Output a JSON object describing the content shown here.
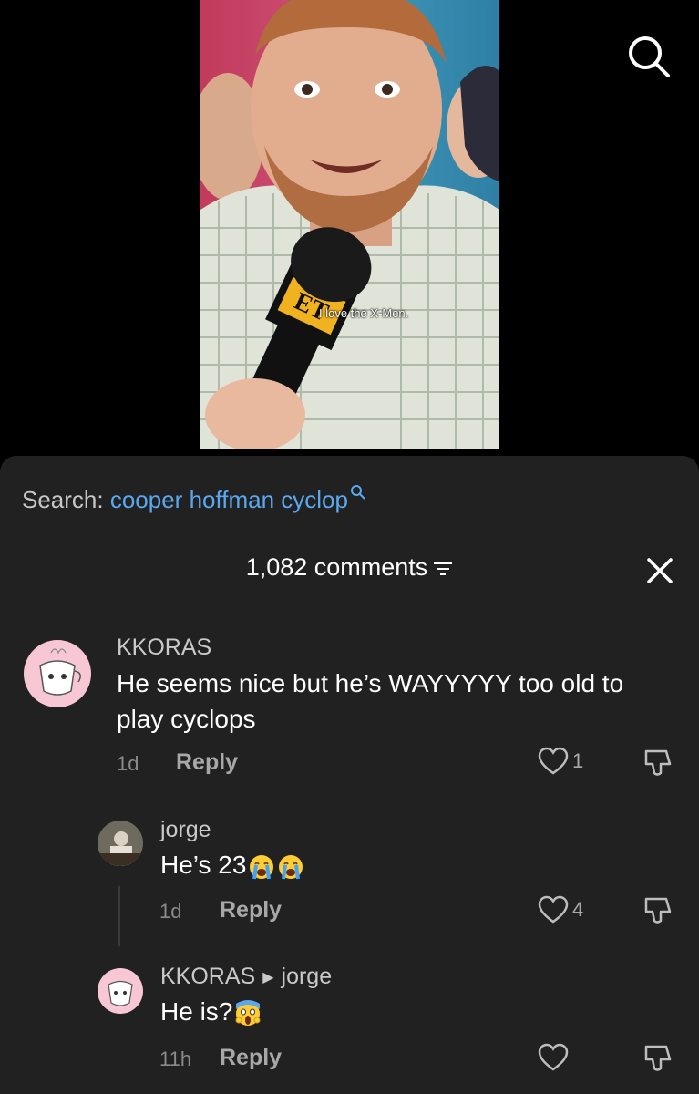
{
  "video": {
    "caption": "I love the X-Men.",
    "mic_logo": "ET",
    "search_icon": "search-icon"
  },
  "search": {
    "prefix": "Search:",
    "term": "cooper hoffman cyclop"
  },
  "header": {
    "comment_count": "1,082 comments",
    "filter_icon": "filter-icon",
    "close_icon": "close-icon"
  },
  "comments": [
    {
      "username": "KKORAS",
      "text": "He seems nice but he’s WAYYYYY too old to play cyclops",
      "time": "1d",
      "reply_label": "Reply",
      "likes": "1"
    },
    {
      "username": "jorge",
      "text": "He’s 23",
      "emojis": [
        "crying-face-emoji",
        "crying-face-emoji"
      ],
      "time": "1d",
      "reply_label": "Reply",
      "likes": "4"
    },
    {
      "username": "KKORAS",
      "reply_to": "jorge",
      "text": "He is?",
      "emojis": [
        "screaming-face-emoji"
      ],
      "time": "11h",
      "reply_label": "Reply",
      "likes": ""
    }
  ],
  "colors": {
    "sheet_bg": "#212121",
    "search_term": "#5aa9f0",
    "muted_text": "#8a8a8a"
  }
}
